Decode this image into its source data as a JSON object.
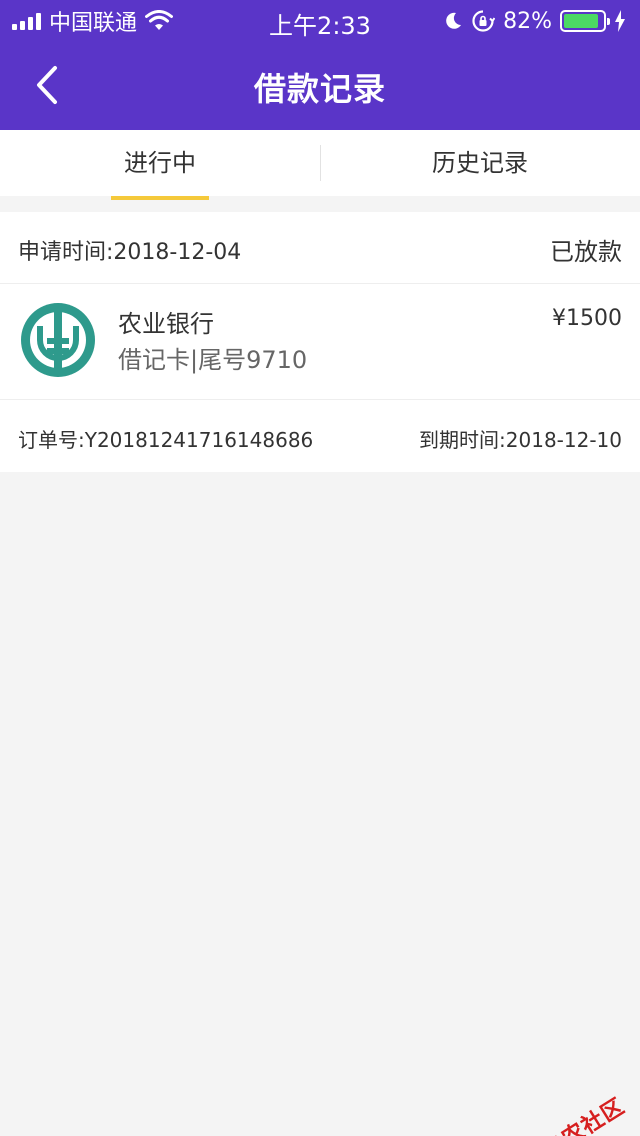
{
  "status_bar": {
    "carrier": "中国联通",
    "time": "上午2:33",
    "battery_percent": "82%",
    "icons": [
      "signal-icon",
      "wifi-icon",
      "moon-icon",
      "rotation-lock-icon",
      "battery-icon",
      "charging-bolt-icon"
    ]
  },
  "nav": {
    "title": "借款记录",
    "back_icon": "chevron-left-icon"
  },
  "tabs": [
    {
      "label": "进行中",
      "active": true
    },
    {
      "label": "历史记录",
      "active": false
    }
  ],
  "colors": {
    "header": "#5a35c8",
    "tab_indicator": "#f5c93a",
    "bank_logo": "#2e9a8c",
    "battery": "#4cd964",
    "watermark": "#d61f1f"
  },
  "loan": {
    "apply_time": "申请时间:2018-12-04",
    "status": "已放款",
    "bank_name": "农业银行",
    "card_info": "借记卡|尾号9710",
    "amount": "¥1500",
    "order_no": "订单号:Y20181241716148686",
    "due_time": "到期时间:2018-12-10"
  },
  "watermark": {
    "text": "卡农社区"
  }
}
